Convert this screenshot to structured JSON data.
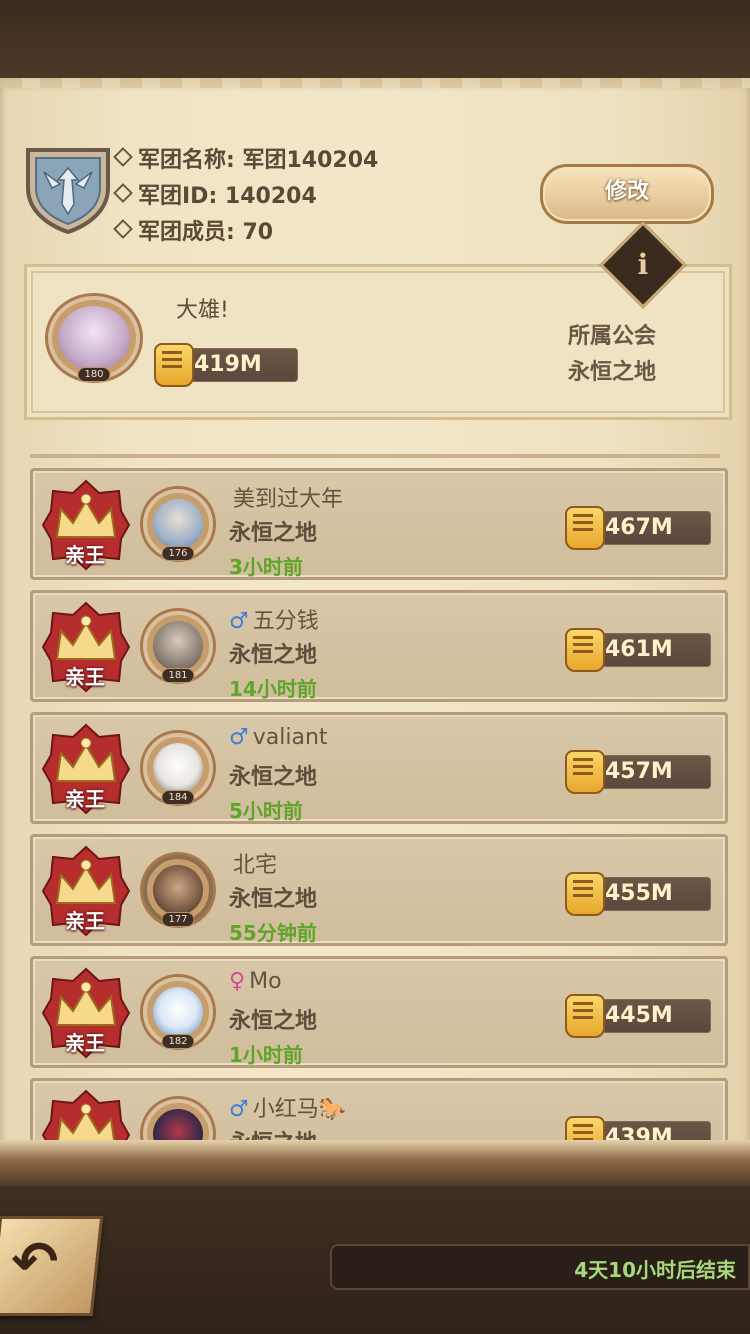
{
  "header": {
    "legion_name": "军团名称: 军团140204",
    "legion_id": "军团ID: 140204",
    "legion_members": "军团成员: 70",
    "edit_button": "修改",
    "info_icon": "i"
  },
  "leader": {
    "name": "大雄!",
    "level": "180",
    "power": "419M",
    "guild_label": "所属公会",
    "guild_name": "永恒之地"
  },
  "members": [
    {
      "rank": "亲王",
      "gender": "",
      "name": "美到过大年",
      "guild": "永恒之地",
      "last_online": "3小时前",
      "level": "176",
      "power": "467M"
    },
    {
      "rank": "亲王",
      "gender": "♂",
      "name": "五分钱",
      "guild": "永恒之地",
      "last_online": "14小时前",
      "level": "181",
      "power": "461M"
    },
    {
      "rank": "亲王",
      "gender": "♂",
      "name": "valiant",
      "guild": "永恒之地",
      "last_online": "5小时前",
      "level": "184",
      "power": "457M"
    },
    {
      "rank": "亲王",
      "gender": "",
      "name": "北宅",
      "guild": "永恒之地",
      "last_online": "55分钟前",
      "level": "177",
      "power": "455M"
    },
    {
      "rank": "亲王",
      "gender": "♀",
      "name": "Mo",
      "guild": "永恒之地",
      "last_online": "1小时前",
      "level": "182",
      "power": "445M"
    },
    {
      "rank": "亲王",
      "gender": "♂",
      "name": "小红马🐎",
      "guild": "永恒之地",
      "last_online": "",
      "level": "",
      "power": "439M"
    }
  ],
  "footer": {
    "timer_text": "4天10小时后结束",
    "back_icon": "back-arrow-icon"
  },
  "colors": {
    "male": "#3f7fd6",
    "female": "#d84a8e",
    "time_green": "#5fa52a",
    "timer_green": "#a7d97b"
  }
}
